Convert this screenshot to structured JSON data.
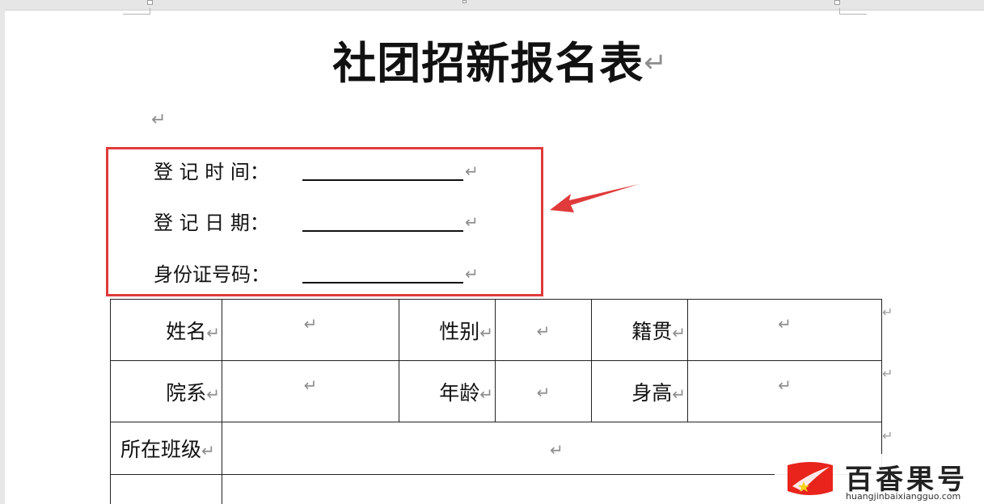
{
  "document": {
    "title": "社团招新报名表",
    "paragraph_mark": "↵",
    "fields": [
      {
        "label": "登 记 时 间："
      },
      {
        "label": "登 记 日 期："
      },
      {
        "label": "身份证号码："
      }
    ],
    "table": {
      "row1": [
        "姓名",
        "性别",
        "籍贯"
      ],
      "row2": [
        "院系",
        "年龄",
        "身高"
      ],
      "row3": [
        "所在班级"
      ]
    }
  },
  "annotation": {
    "box_color": "#e03a3a",
    "arrow_color": "#e03a3a"
  },
  "watermark": {
    "brand": "百香果号",
    "url": "huangjinbaixiangguo.com"
  }
}
